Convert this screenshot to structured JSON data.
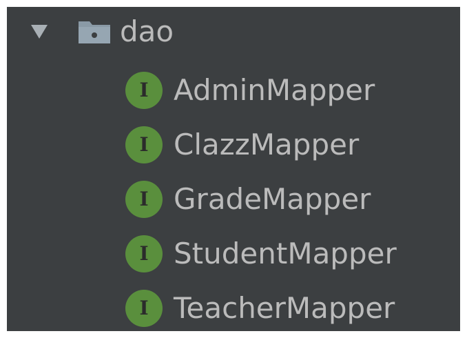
{
  "tree": {
    "folder": {
      "icon": "folder-icon",
      "expanded_icon": "triangle-down-icon",
      "label": "dao"
    },
    "items": [
      {
        "icon": "interface-icon",
        "letter": "I",
        "label": "AdminMapper"
      },
      {
        "icon": "interface-icon",
        "letter": "I",
        "label": "ClazzMapper"
      },
      {
        "icon": "interface-icon",
        "letter": "I",
        "label": "GradeMapper"
      },
      {
        "icon": "interface-icon",
        "letter": "I",
        "label": "StudentMapper"
      },
      {
        "icon": "interface-icon",
        "letter": "I",
        "label": "TeacherMapper"
      }
    ]
  },
  "colors": {
    "panel_background": "#3c3f41",
    "text": "#bbbbbb",
    "interface_icon": "#5a8f3d",
    "folder_icon": "#8a9aa6"
  }
}
